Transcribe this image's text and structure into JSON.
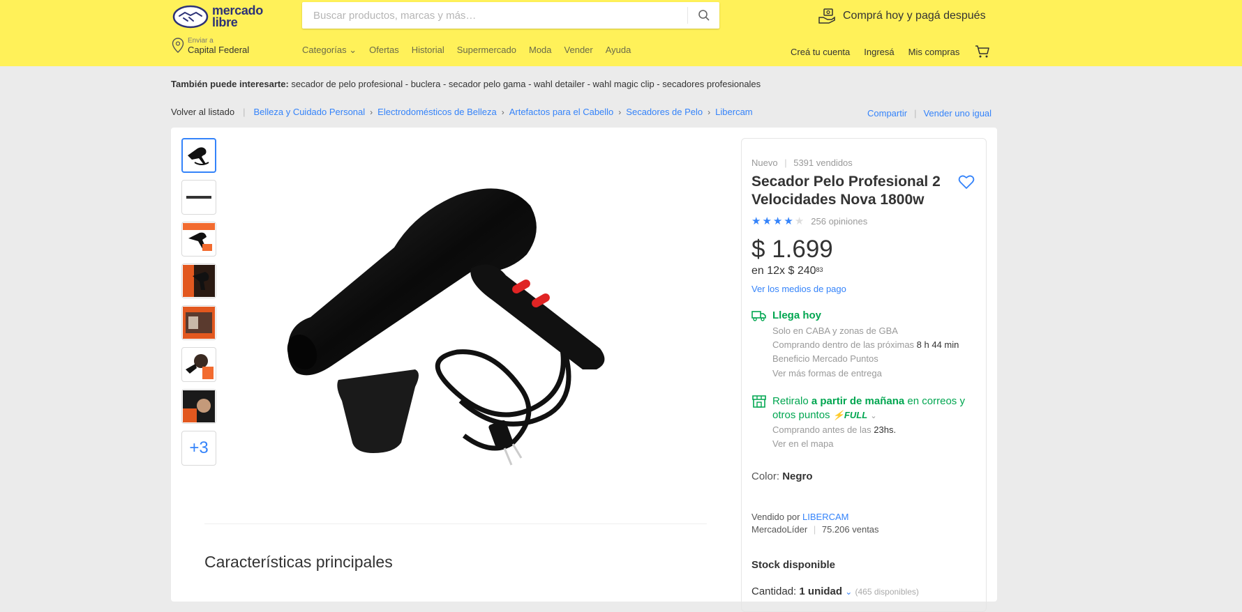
{
  "header": {
    "logo_line1": "mercado",
    "logo_line2": "libre",
    "search_placeholder": "Buscar productos, marcas y más…",
    "promo_text": "Comprá hoy y pagá después",
    "location_label": "Enviar a",
    "location_value": "Capital Federal",
    "nav": [
      "Categorías",
      "Ofertas",
      "Historial",
      "Supermercado",
      "Moda",
      "Vender",
      "Ayuda"
    ],
    "user_nav": [
      "Creá tu cuenta",
      "Ingresá",
      "Mis compras"
    ]
  },
  "also": {
    "label": "También puede interesarte:",
    "text": " secador de pelo profesional - buclera - secador pelo gama - wahl detailer - wahl magic clip - secadores profesionales"
  },
  "breadcrumb": {
    "back": "Volver al listado",
    "items": [
      "Belleza y Cuidado Personal",
      "Electrodomésticos de Belleza",
      "Artefactos para el Cabello",
      "Secadores de Pelo",
      "Libercam"
    ],
    "share": "Compartir",
    "sell_same": "Vender uno igual"
  },
  "gallery": {
    "more_label": "+3"
  },
  "product": {
    "condition": "Nuevo",
    "sold": "5391 vendidos",
    "title": "Secador Pelo Profesional 2 Velocidades Nova 1800w",
    "rating": 4,
    "reviews": "256 opiniones",
    "price": "$ 1.699",
    "installments_prefix": "en 12x $ 240",
    "installments_cents": "83",
    "payment_link": "Ver los medios de pago",
    "shipping": {
      "title": "Llega hoy",
      "line1": "Solo en CABA y zonas de GBA",
      "line2_prefix": "Comprando dentro de las próximas ",
      "line2_time": "8 h 44 min",
      "line3": "Beneficio Mercado Puntos",
      "link": "Ver más formas de entrega"
    },
    "pickup": {
      "prefix": "Retiralo ",
      "bold": "a partir de mañana",
      "suffix": " en correos y otros puntos",
      "full": "FULL",
      "line_prefix": "Comprando antes de las ",
      "line_time": "23hs.",
      "link": "Ver en el mapa"
    },
    "color_label": "Color: ",
    "color_value": "Negro",
    "seller_prefix": "Vendido por ",
    "seller_name": "LIBERCAM",
    "seller_badge": "MercadoLíder",
    "seller_sales": "75.206 ventas",
    "stock": "Stock disponible",
    "qty_label": "Cantidad: ",
    "qty_value": "1 unidad",
    "qty_available": "(465 disponibles)"
  },
  "features_title": "Características principales",
  "colors": {
    "header_bg": "#fff159",
    "accent_blue": "#3483fa",
    "success_green": "#00a650"
  }
}
